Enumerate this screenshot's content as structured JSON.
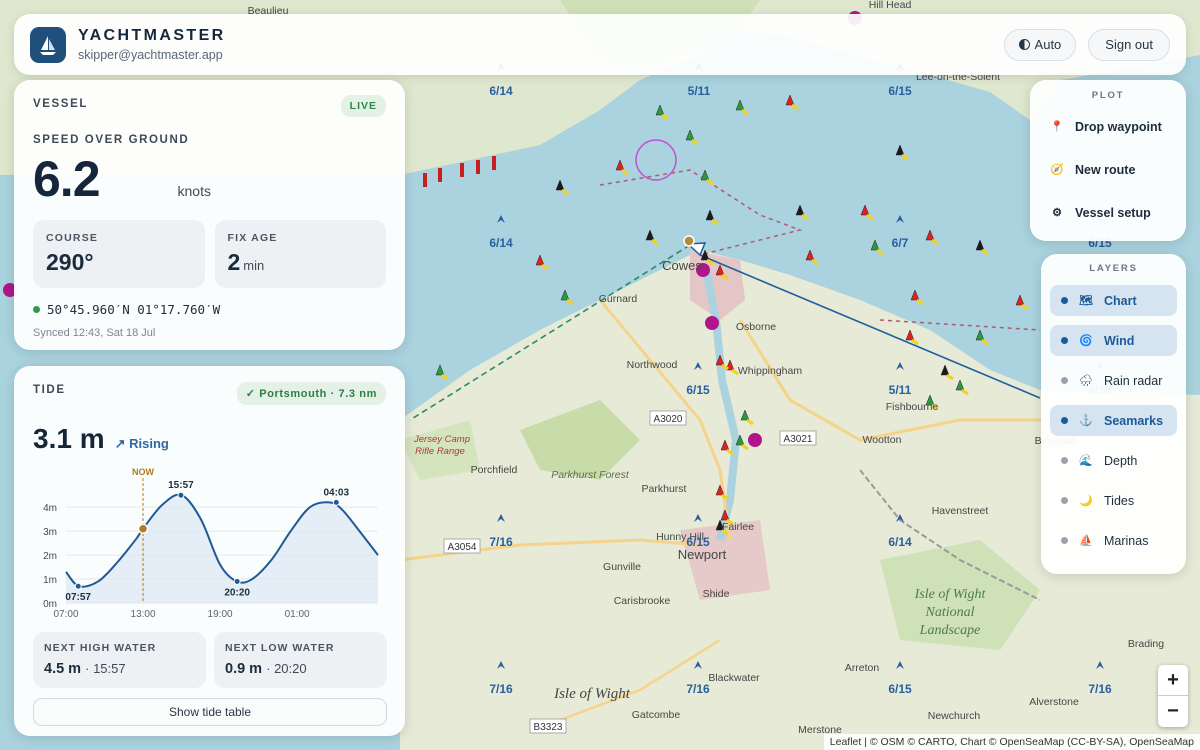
{
  "header": {
    "app_name": "YACHTMASTER",
    "email": "skipper@yachtmaster.app",
    "theme_button": "Auto",
    "sign_out": "Sign out"
  },
  "vessel": {
    "title": "VESSEL",
    "status": "LIVE",
    "sog_label": "SPEED OVER GROUND",
    "sog_value": "6.2",
    "sog_unit": "knots",
    "course_label": "COURSE",
    "course_value": "290°",
    "fix_label": "FIX AGE",
    "fix_value": "2",
    "fix_unit": "min",
    "position": "50°45.960′N 01°17.760′W",
    "synced": "Synced 12:43, Sat 18 Jul"
  },
  "tide": {
    "title": "TIDE",
    "station": "✓ Portsmouth · 7.3 nm",
    "height": "3.1 m",
    "trend": "↗ Rising",
    "next_high_label": "NEXT HIGH WATER",
    "next_high_height": "4.5 m",
    "next_high_time": "· 15:57",
    "next_low_label": "NEXT LOW WATER",
    "next_low_height": "0.9 m",
    "next_low_time": "· 20:20",
    "table_button": "Show tide table"
  },
  "chart_data": {
    "type": "line",
    "y_ticks": [
      "0m",
      "1m",
      "2m",
      "3m",
      "4m"
    ],
    "x_ticks": [
      "07:00",
      "13:00",
      "19:00",
      "01:00"
    ],
    "now_label": "NOW",
    "ylim": [
      0,
      4.8
    ],
    "points": [
      {
        "t": 7.0,
        "h": 1.3
      },
      {
        "t": 8.0,
        "h": 0.7
      },
      {
        "t": 9.5,
        "h": 0.9
      },
      {
        "t": 11.0,
        "h": 1.7
      },
      {
        "t": 12.5,
        "h": 2.7
      },
      {
        "t": 13.0,
        "h": 3.1
      },
      {
        "t": 14.5,
        "h": 4.1
      },
      {
        "t": 16.0,
        "h": 4.5
      },
      {
        "t": 17.5,
        "h": 3.5
      },
      {
        "t": 19.0,
        "h": 1.6
      },
      {
        "t": 20.3,
        "h": 0.9
      },
      {
        "t": 21.5,
        "h": 1.0
      },
      {
        "t": 23.0,
        "h": 1.8
      },
      {
        "t": 24.5,
        "h": 3.0
      },
      {
        "t": 26.0,
        "h": 4.0
      },
      {
        "t": 27.5,
        "h": 4.2
      },
      {
        "t": 28.5,
        "h": 3.9
      },
      {
        "t": 30.0,
        "h": 2.9
      },
      {
        "t": 31.3,
        "h": 2.0
      }
    ],
    "extremes": [
      {
        "t": 7.95,
        "h": 0.7,
        "label": "07:57"
      },
      {
        "t": 15.95,
        "h": 4.5,
        "label": "15:57"
      },
      {
        "t": 20.33,
        "h": 0.9,
        "label": "20:20"
      },
      {
        "t": 28.05,
        "h": 4.2,
        "label": "04:03"
      }
    ],
    "now": {
      "t": 13.0,
      "h": 3.1
    },
    "trange": [
      7.0,
      31.3
    ]
  },
  "plot_menu": {
    "title": "PLOT",
    "items": [
      {
        "label": "Drop waypoint",
        "icon": "pin-icon"
      },
      {
        "label": "New route",
        "icon": "compass-icon"
      },
      {
        "label": "Vessel setup",
        "icon": "gear-icon"
      }
    ]
  },
  "layers_menu": {
    "title": "LAYERS",
    "items": [
      {
        "label": "Chart",
        "on": true
      },
      {
        "label": "Wind",
        "on": true
      },
      {
        "label": "Rain radar",
        "on": false
      },
      {
        "label": "Seamarks",
        "on": true
      },
      {
        "label": "Depth",
        "on": false
      },
      {
        "label": "Tides",
        "on": false
      },
      {
        "label": "Marinas",
        "on": false
      }
    ]
  },
  "map": {
    "places": [
      "Hill Head",
      "Lee-on-the-Solent",
      "Cowes",
      "Gurnard",
      "Osborne",
      "Northwood",
      "Whippingham",
      "Fishbourne",
      "Binstead",
      "Wootton",
      "Porchfield",
      "Parkhurst Forest",
      "Parkhurst",
      "Havenstreet",
      "Newport",
      "Fairlee",
      "Hunny Hill",
      "Gunville",
      "Carisbrooke",
      "Shide",
      "Blackwater",
      "Arreton",
      "Alverstone",
      "Brading",
      "Gatcombe",
      "Merstone",
      "Newchurch",
      "Beaulieu"
    ],
    "park_name": "Isle of Wight National Landscape",
    "island_name": "Isle of Wight",
    "range_name": "Jersey Camp Rifle Range",
    "roads": [
      "A3020",
      "A3021",
      "A3054",
      "B3323"
    ],
    "tide_labels": [
      "6/14",
      "5/11",
      "6/15",
      "6/14",
      "6/7",
      "6/15",
      "6/15",
      "5/11",
      "6/15",
      "7/16",
      "6/15",
      "6/14",
      "7/16",
      "7/16",
      "6/15",
      "7/16"
    ],
    "zoom_in": "+",
    "zoom_out": "−",
    "attribution": "Leaflet | © OSM © CARTO, Chart © OpenSeaMap (CC-BY-SA), OpenSeaMap"
  },
  "colors": {
    "sea": "#aad3df",
    "land": "#e8ebdc",
    "accent": "#1d5b98",
    "live": "#2f8a4a"
  }
}
